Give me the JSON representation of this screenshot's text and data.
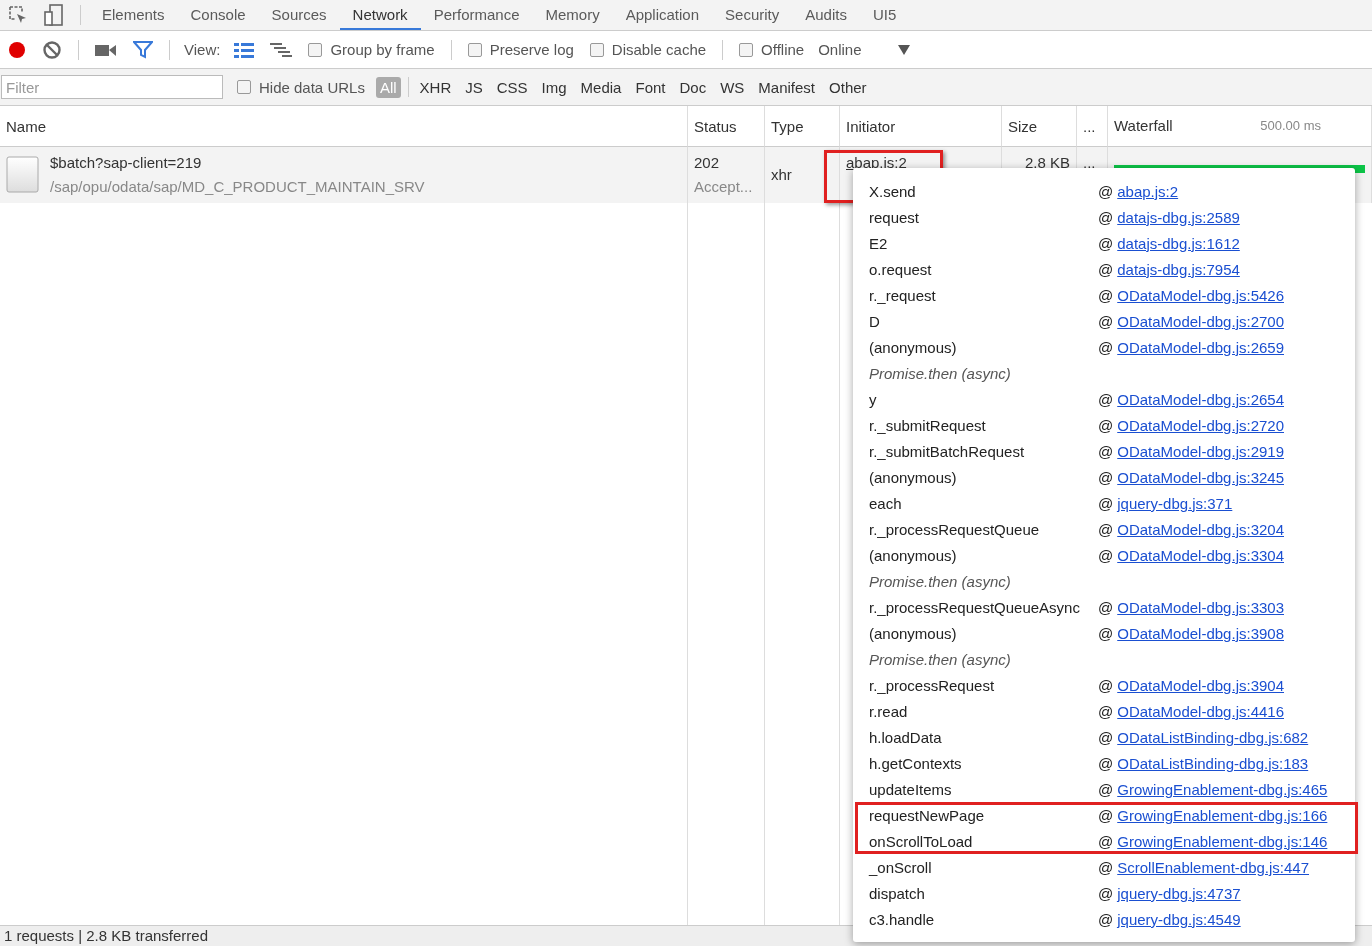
{
  "tabs": [
    {
      "label": "Elements",
      "selected": false
    },
    {
      "label": "Console",
      "selected": false
    },
    {
      "label": "Sources",
      "selected": false
    },
    {
      "label": "Network",
      "selected": true
    },
    {
      "label": "Performance",
      "selected": false
    },
    {
      "label": "Memory",
      "selected": false
    },
    {
      "label": "Application",
      "selected": false
    },
    {
      "label": "Security",
      "selected": false
    },
    {
      "label": "Audits",
      "selected": false
    },
    {
      "label": "UI5",
      "selected": false
    }
  ],
  "toolbar": {
    "recording": true,
    "view_label": "View:",
    "large_rows": true,
    "checkboxes": [
      {
        "label": "Group by frame",
        "checked": false
      },
      {
        "label": "Preserve log",
        "checked": false
      },
      {
        "label": "Disable cache",
        "checked": false
      },
      {
        "label": "Offline",
        "checked": false
      }
    ],
    "throttling": "Online"
  },
  "filter_bar": {
    "placeholder": "Filter",
    "hide_data_urls": {
      "label": "Hide data URLs",
      "checked": false
    },
    "types": [
      {
        "label": "All",
        "selected": true
      },
      {
        "label": "XHR",
        "selected": false
      },
      {
        "label": "JS",
        "selected": false
      },
      {
        "label": "CSS",
        "selected": false
      },
      {
        "label": "Img",
        "selected": false
      },
      {
        "label": "Media",
        "selected": false
      },
      {
        "label": "Font",
        "selected": false
      },
      {
        "label": "Doc",
        "selected": false
      },
      {
        "label": "WS",
        "selected": false
      },
      {
        "label": "Manifest",
        "selected": false
      },
      {
        "label": "Other",
        "selected": false
      }
    ]
  },
  "table": {
    "columns": [
      "Name",
      "Status",
      "Type",
      "Initiator",
      "Size",
      "...",
      "Waterfall"
    ],
    "waterfall_scale": "500.00 ms",
    "rows": [
      {
        "name": "$batch?sap-client=219",
        "path": "/sap/opu/odata/sap/MD_C_PRODUCT_MAINTAIN_SRV",
        "status": "202",
        "status_text": "Accept...",
        "type": "xhr",
        "initiator": "abap.js:2",
        "initiator_highlighted": true,
        "size": "2.8 KB",
        "more": "..."
      }
    ]
  },
  "initiator_popup": {
    "frames": [
      {
        "kind": "frame",
        "function": "X.send",
        "at": "@",
        "link": "abap.js:2"
      },
      {
        "kind": "frame",
        "function": "request",
        "at": "@",
        "link": "datajs-dbg.js:2589",
        "highlighted": false
      },
      {
        "kind": "frame",
        "function": "E2",
        "at": "@",
        "link": "datajs-dbg.js:1612",
        "highlighted": false
      },
      {
        "kind": "frame",
        "function": "o.request",
        "at": "@",
        "link": "datajs-dbg.js:7954",
        "highlighted": false
      },
      {
        "kind": "frame",
        "function": "r._request",
        "at": "@",
        "link": "ODataModel-dbg.js:5426",
        "highlighted": false
      },
      {
        "kind": "frame",
        "function": "D",
        "at": "@",
        "link": "ODataModel-dbg.js:2700",
        "highlighted": false
      },
      {
        "kind": "frame",
        "function": "(anonymous)",
        "at": "@",
        "link": "ODataModel-dbg.js:2659",
        "highlighted": false
      },
      {
        "kind": "async",
        "function": "Promise.then (async)"
      },
      {
        "kind": "frame",
        "function": "y",
        "at": "@",
        "link": "ODataModel-dbg.js:2654",
        "highlighted": false
      },
      {
        "kind": "frame",
        "function": "r._submitRequest",
        "at": "@",
        "link": "ODataModel-dbg.js:2720",
        "highlighted": false
      },
      {
        "kind": "frame",
        "function": "r._submitBatchRequest",
        "at": "@",
        "link": "ODataModel-dbg.js:2919",
        "highlighted": false
      },
      {
        "kind": "frame",
        "function": "(anonymous)",
        "at": "@",
        "link": "ODataModel-dbg.js:3245",
        "highlighted": false
      },
      {
        "kind": "frame",
        "function": "each",
        "at": "@",
        "link": "jquery-dbg.js:371",
        "highlighted": false
      },
      {
        "kind": "frame",
        "function": "r._processRequestQueue",
        "at": "@",
        "link": "ODataModel-dbg.js:3204",
        "highlighted": false
      },
      {
        "kind": "frame",
        "function": "(anonymous)",
        "at": "@",
        "link": "ODataModel-dbg.js:3304",
        "highlighted": false
      },
      {
        "kind": "async",
        "function": "Promise.then (async)"
      },
      {
        "kind": "frame",
        "function": "r._processRequestQueueAsync",
        "at": "@",
        "link": "ODataModel-dbg.js:3303",
        "highlighted": false
      },
      {
        "kind": "frame",
        "function": "(anonymous)",
        "at": "@",
        "link": "ODataModel-dbg.js:3908",
        "highlighted": false
      },
      {
        "kind": "async",
        "function": "Promise.then (async)"
      },
      {
        "kind": "frame",
        "function": "r._processRequest",
        "at": "@",
        "link": "ODataModel-dbg.js:3904",
        "highlighted": false
      },
      {
        "kind": "frame",
        "function": "r.read",
        "at": "@",
        "link": "ODataModel-dbg.js:4416",
        "highlighted": false
      },
      {
        "kind": "frame",
        "function": "h.loadData",
        "at": "@",
        "link": "ODataListBinding-dbg.js:682",
        "highlighted": false
      },
      {
        "kind": "frame",
        "function": "h.getContexts",
        "at": "@",
        "link": "ODataListBinding-dbg.js:183",
        "highlighted": false
      },
      {
        "kind": "frame",
        "function": "updateItems",
        "at": "@",
        "link": "GrowingEnablement-dbg.js:465",
        "highlighted": false
      },
      {
        "kind": "frame",
        "function": "requestNewPage",
        "at": "@",
        "link": "GrowingEnablement-dbg.js:166",
        "highlighted": true
      },
      {
        "kind": "frame",
        "function": "onScrollToLoad",
        "at": "@",
        "link": "GrowingEnablement-dbg.js:146",
        "highlighted": true
      },
      {
        "kind": "frame",
        "function": "_onScroll",
        "at": "@",
        "link": "ScrollEnablement-dbg.js:447",
        "highlighted": false
      },
      {
        "kind": "frame",
        "function": "dispatch",
        "at": "@",
        "link": "jquery-dbg.js:4737",
        "highlighted": false
      },
      {
        "kind": "frame",
        "function": "c3.handle",
        "at": "@",
        "link": "jquery-dbg.js:4549",
        "highlighted": false
      }
    ]
  },
  "status_bar": "1 requests | 2.8 KB transferred"
}
